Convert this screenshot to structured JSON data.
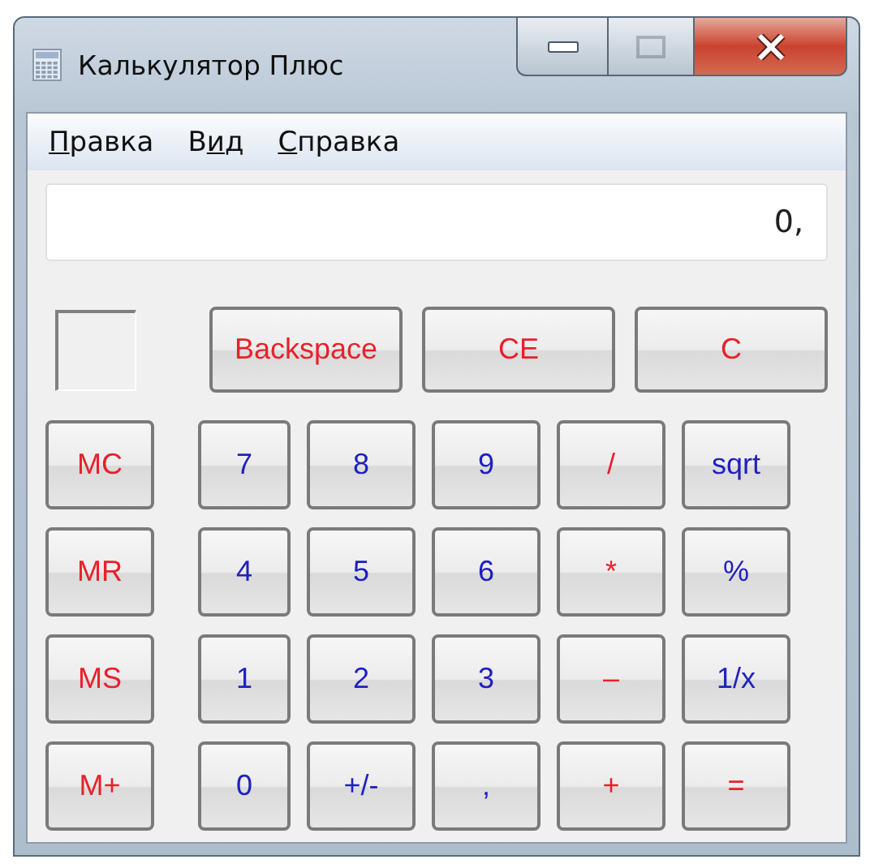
{
  "window": {
    "title": "Калькулятор Плюс",
    "controls": [
      {
        "kind": "minimize",
        "disabled": false
      },
      {
        "kind": "maximize",
        "disabled": true
      },
      {
        "kind": "close",
        "disabled": false
      }
    ]
  },
  "menu": [
    {
      "mnemonic": "П",
      "after": "равка"
    },
    {
      "before": "В",
      "mnemonic": "и",
      "after": "д"
    },
    {
      "mnemonic": "С",
      "after": "правка"
    }
  ],
  "display": {
    "value": "0,"
  },
  "memory_indicator": {
    "on": false
  },
  "top_buttons": [
    {
      "label": "Backspace",
      "color": "#e8202a"
    },
    {
      "label": "CE",
      "color": "#e8202a"
    },
    {
      "label": "C",
      "color": "#e8202a"
    }
  ],
  "keypad": [
    [
      {
        "label": "MC",
        "color": "#e8202a"
      },
      {
        "label": "7",
        "color": "#2020c0"
      },
      {
        "label": "8",
        "color": "#2020c0"
      },
      {
        "label": "9",
        "color": "#2020c0"
      },
      {
        "label": "/",
        "color": "#e8202a"
      },
      {
        "label": "sqrt",
        "color": "#2020c0"
      }
    ],
    [
      {
        "label": "MR",
        "color": "#e8202a"
      },
      {
        "label": "4",
        "color": "#2020c0"
      },
      {
        "label": "5",
        "color": "#2020c0"
      },
      {
        "label": "6",
        "color": "#2020c0"
      },
      {
        "label": "*",
        "color": "#e8202a"
      },
      {
        "label": "%",
        "color": "#2020c0"
      }
    ],
    [
      {
        "label": "MS",
        "color": "#e8202a"
      },
      {
        "label": "1",
        "color": "#2020c0"
      },
      {
        "label": "2",
        "color": "#2020c0"
      },
      {
        "label": "3",
        "color": "#2020c0"
      },
      {
        "label": "–",
        "color": "#e8202a"
      },
      {
        "label": "1/x",
        "color": "#2020c0"
      }
    ],
    [
      {
        "label": "M+",
        "color": "#e8202a"
      },
      {
        "label": "0",
        "color": "#2020c0"
      },
      {
        "label": "+/-",
        "color": "#2020c0"
      },
      {
        "label": ",",
        "color": "#2020c0"
      },
      {
        "label": "+",
        "color": "#e8202a"
      },
      {
        "label": "=",
        "color": "#e8202a"
      }
    ]
  ]
}
